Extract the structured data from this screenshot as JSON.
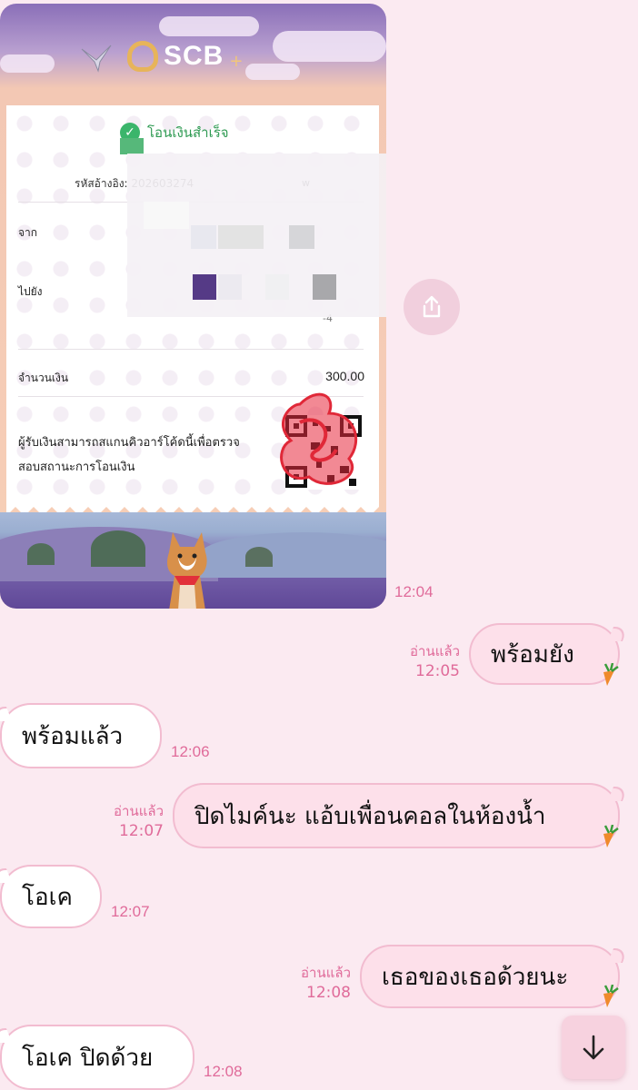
{
  "slip": {
    "brand": "SCB",
    "brand_plus": "+",
    "status": "โอนเงินสำเร็จ",
    "ref_label": "รหัสอ้างอิง: 202603274",
    "ref_suffix": "w",
    "from_label": "จาก",
    "to_label": "ไปยัง",
    "to_suffix": "-4",
    "amount_label": "จำนวนเงิน",
    "amount_value": "300.00",
    "qr_note": "ผู้รับเงินสามารถสแกนคิวอาร์โค้ดนี้เพื่อตรวจสอบสถานะการโอนเงิน",
    "time": "12:04"
  },
  "icons": {
    "share": "share-icon",
    "carrot": "carrot-sticker-icon",
    "scroll_down": "arrow-down-icon"
  },
  "messages": [
    {
      "side": "right",
      "text": "พร้อมยัง",
      "read": "อ่านแล้ว",
      "time": "12:05"
    },
    {
      "side": "left",
      "text": "พร้อมแล้ว",
      "time": "12:06"
    },
    {
      "side": "right",
      "text": "ปิดไมค์นะ แอ้บเพื่อนคอลในห้องน้ำ",
      "read": "อ่านแล้ว",
      "time": "12:07"
    },
    {
      "side": "left",
      "text": "โอเค",
      "time": "12:07"
    },
    {
      "side": "right",
      "text": "เธอของเธอด้วยนะ",
      "read": "อ่านแล้ว",
      "time": "12:08"
    },
    {
      "side": "left",
      "text": "โอเค ปิดด้วย",
      "time": "12:08"
    }
  ],
  "colors": {
    "background": "#fbeaf1",
    "bubble_mine": "#fde0ea",
    "bubble_border": "#f2bcd0",
    "time_text": "#e06b9a"
  }
}
